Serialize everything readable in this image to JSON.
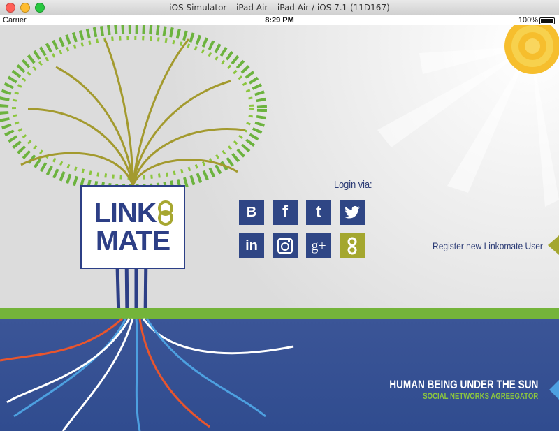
{
  "window": {
    "title": "iOS Simulator – iPad Air – iPad Air / iOS 7.1 (11D167)"
  },
  "statusbar": {
    "carrier": "Carrier",
    "time": "8:29 PM",
    "battery": "100%"
  },
  "logo": {
    "line1": "LINK",
    "line2": "MATE"
  },
  "login": {
    "label": "Login via:",
    "services": [
      {
        "name": "blogger",
        "glyph": "B"
      },
      {
        "name": "facebook",
        "glyph": "f"
      },
      {
        "name": "tumblr",
        "glyph": "t"
      },
      {
        "name": "twitter",
        "glyph": ""
      },
      {
        "name": "linkedin",
        "glyph": "in"
      },
      {
        "name": "instagram",
        "glyph": ""
      },
      {
        "name": "google-plus",
        "glyph": "g+"
      },
      {
        "name": "linkomate",
        "glyph": ""
      }
    ]
  },
  "register": {
    "label": "Register new Linkomate User"
  },
  "tagline": {
    "main": "HUMAN BEING UNDER THE SUN",
    "sub": "SOCIAL NETWORKS AGREEGATOR"
  },
  "colors": {
    "navy": "#2f4685",
    "olive": "#a4a72f",
    "leaf": "#6cb33e",
    "root_red": "#e8552d",
    "root_blue": "#4da0e0"
  }
}
